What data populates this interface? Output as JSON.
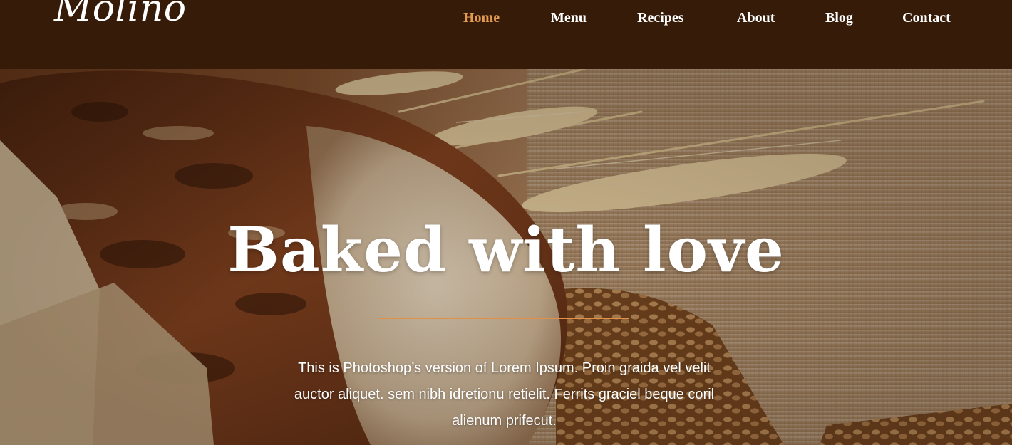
{
  "brand": {
    "logo_text": "Molino"
  },
  "nav": {
    "items": [
      {
        "label": "Home",
        "active": true
      },
      {
        "label": "Menu",
        "active": false
      },
      {
        "label": "Recipes",
        "active": false
      },
      {
        "label": "About",
        "active": false
      },
      {
        "label": "Blog",
        "active": false
      },
      {
        "label": "Contact",
        "active": false
      }
    ]
  },
  "hero": {
    "title": "Baked with love",
    "description": "This is Photoshop’s version of Lorem Ipsum. Proin graida vel velit auctor aliquet. sem nibh idretionu retielit. Ferrits graciel beque coril alienum prifecut."
  },
  "colors": {
    "header_bg": "#361c08",
    "accent": "#e39a52",
    "text": "#ffffff"
  }
}
